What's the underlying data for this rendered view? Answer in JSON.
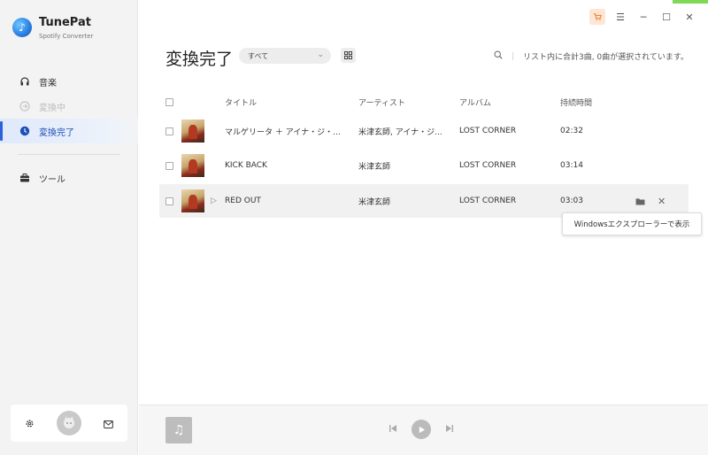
{
  "app": {
    "name": "TunePat",
    "subtitle": "Spotify Converter"
  },
  "sidebar": {
    "items": [
      {
        "label": "音楽",
        "icon": "headphones-icon"
      },
      {
        "label": "変換中",
        "icon": "converting-icon"
      },
      {
        "label": "変換完了",
        "icon": "clock-icon"
      },
      {
        "label": "ツール",
        "icon": "toolbox-icon"
      }
    ]
  },
  "header": {
    "title": "変換完了",
    "filter_value": "すべて",
    "status": "リスト内に合計3曲, 0曲が選択されています。"
  },
  "table": {
    "columns": {
      "title": "タイトル",
      "artist": "アーティスト",
      "album": "アルバム",
      "duration": "持続時間"
    },
    "rows": [
      {
        "title": "マルゲリータ ＋ アイナ・ジ・...",
        "artist": "米津玄師, アイナ・ジ...",
        "album": "LOST CORNER",
        "duration": "02:32"
      },
      {
        "title": "KICK BACK",
        "artist": "米津玄師",
        "album": "LOST CORNER",
        "duration": "03:14"
      },
      {
        "title": "RED OUT",
        "artist": "米津玄師",
        "album": "LOST CORNER",
        "duration": "03:03"
      }
    ]
  },
  "tooltip": {
    "text": "Windowsエクスプローラーで表示"
  },
  "colors": {
    "accent": "#2a62d9",
    "cart": "#f07a25",
    "top_accent": "#7ed957"
  }
}
